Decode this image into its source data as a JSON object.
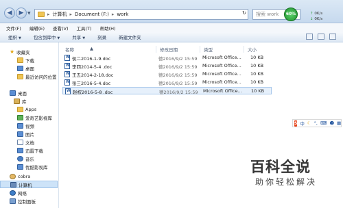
{
  "address": {
    "segments": [
      "计算机",
      "Document (F:)",
      "work"
    ],
    "search_placeholder": "搜索 work"
  },
  "net_monitor": {
    "percent": "60%",
    "upload": "0K/s",
    "download": "0K/s",
    "color": "#2d9a3a"
  },
  "menu": [
    "文件(F)",
    "编辑(E)",
    "查看(V)",
    "工具(T)",
    "帮助(H)"
  ],
  "toolbar": {
    "organize": "组织",
    "include_in_library": "包含到库中",
    "share": "共享",
    "burn": "刻录",
    "new_folder": "新建文件夹"
  },
  "sidebar": {
    "items": [
      {
        "label": "收藏夹",
        "icon": "star-icon"
      },
      {
        "label": "下载",
        "icon": "download-folder-icon"
      },
      {
        "label": "桌面",
        "icon": "desktop-icon"
      },
      {
        "label": "最近访问的位置",
        "icon": "recent-places-icon"
      },
      {
        "label": "桌面",
        "icon": "desktop-icon"
      },
      {
        "label": "库",
        "icon": "library-icon"
      },
      {
        "label": "Apps",
        "icon": "apps-icon"
      },
      {
        "label": "爱奇艺影视库",
        "icon": "iqiyi-library-icon"
      },
      {
        "label": "视频",
        "icon": "video-icon"
      },
      {
        "label": "图片",
        "icon": "pictures-icon"
      },
      {
        "label": "文档",
        "icon": "documents-icon"
      },
      {
        "label": "迅雷下载",
        "icon": "xunlei-download-icon"
      },
      {
        "label": "音乐",
        "icon": "music-icon"
      },
      {
        "label": "优酷影视库",
        "icon": "youku-library-icon"
      },
      {
        "label": "cobra",
        "icon": "user-icon"
      },
      {
        "label": "计算机",
        "icon": "computer-icon"
      },
      {
        "label": "网络",
        "icon": "network-icon"
      },
      {
        "label": "控制面板",
        "icon": "control-panel-icon"
      }
    ]
  },
  "columns": {
    "name": "名称",
    "date": "修改日期",
    "type": "类型",
    "size": "大小"
  },
  "files": [
    {
      "name": "侯二2016-1-9.doc",
      "date": "德2016/9/2 15:59",
      "type": "Microsoft Office...",
      "size": "10 KB"
    },
    {
      "name": "李四2014-5-4 .doc",
      "date": "德2016/9/2 15:59",
      "type": "Microsoft Office...",
      "size": "10 KB"
    },
    {
      "name": "王五2014-2-18.doc",
      "date": "德2016/9/2 15:59",
      "type": "Microsoft Office...",
      "size": "10 KB"
    },
    {
      "name": "张三2016-5-4.doc",
      "date": "德2016/9/2 15:59",
      "type": "Microsoft Office...",
      "size": "10 KB"
    },
    {
      "name": "赵权2016-5-8 .doc",
      "date": "德2016/9/2 15:59",
      "type": "Microsoft Office...",
      "size": "10 KB"
    }
  ],
  "ime": {
    "label": "中"
  },
  "watermark": {
    "title": "百科全说",
    "subtitle": "助你轻松解决"
  }
}
